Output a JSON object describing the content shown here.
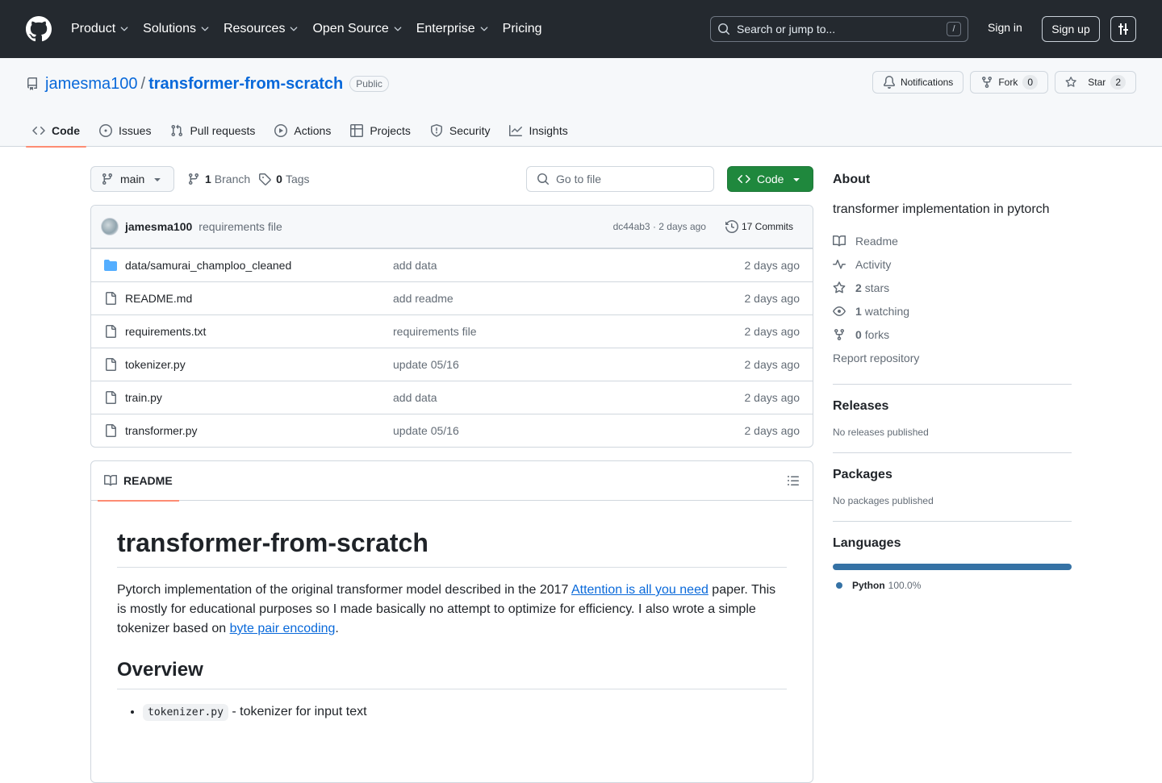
{
  "header": {
    "nav": [
      {
        "label": "Product",
        "dropdown": true
      },
      {
        "label": "Solutions",
        "dropdown": true
      },
      {
        "label": "Resources",
        "dropdown": true
      },
      {
        "label": "Open Source",
        "dropdown": true
      },
      {
        "label": "Enterprise",
        "dropdown": true
      },
      {
        "label": "Pricing",
        "dropdown": false
      }
    ],
    "search_placeholder": "Search or jump to...",
    "search_key": "/",
    "signin": "Sign in",
    "signup": "Sign up"
  },
  "repo": {
    "owner": "jamesma100",
    "separator": "/",
    "name": "transformer-from-scratch",
    "visibility": "Public",
    "notifications_label": "Notifications",
    "fork_label": "Fork",
    "fork_count": "0",
    "star_label": "Star",
    "star_count": "2"
  },
  "repo_nav": [
    {
      "label": "Code",
      "icon": "code-icon",
      "active": true
    },
    {
      "label": "Issues",
      "icon": "issue-icon",
      "active": false
    },
    {
      "label": "Pull requests",
      "icon": "pull-request-icon",
      "active": false
    },
    {
      "label": "Actions",
      "icon": "play-icon",
      "active": false
    },
    {
      "label": "Projects",
      "icon": "table-icon",
      "active": false
    },
    {
      "label": "Security",
      "icon": "shield-icon",
      "active": false
    },
    {
      "label": "Insights",
      "icon": "graph-icon",
      "active": false
    }
  ],
  "toolbar": {
    "branch": "main",
    "branch_count": "1",
    "branch_label": "Branch",
    "tag_count": "0",
    "tag_label": "Tags",
    "goto_placeholder": "Go to file",
    "code_label": "Code"
  },
  "commit": {
    "author": "jamesma100",
    "message": "requirements file",
    "meta": "dc44ab3 · 2 days ago",
    "commits_label": "17 Commits"
  },
  "files": [
    {
      "type": "folder",
      "name": "data/samurai_champloo_cleaned",
      "message": "add data",
      "date": "2 days ago"
    },
    {
      "type": "file",
      "name": "README.md",
      "message": "add readme",
      "date": "2 days ago"
    },
    {
      "type": "file",
      "name": "requirements.txt",
      "message": "requirements file",
      "date": "2 days ago"
    },
    {
      "type": "file",
      "name": "tokenizer.py",
      "message": "update 05/16",
      "date": "2 days ago"
    },
    {
      "type": "file",
      "name": "train.py",
      "message": "add data",
      "date": "2 days ago"
    },
    {
      "type": "file",
      "name": "transformer.py",
      "message": "update 05/16",
      "date": "2 days ago"
    }
  ],
  "readme": {
    "tab_label": "README",
    "title": "transformer-from-scratch",
    "p1_before": "Pytorch implementation of the original transformer model described in the 2017 ",
    "p1_link": "Attention is all you need",
    "p1_middle": " paper. This is mostly for educational purposes so I made basically no attempt to optimize for efficiency. I also wrote a simple tokenizer based on ",
    "p1_link2": "byte pair encoding",
    "p1_after": ".",
    "h2": "Overview",
    "list": [
      {
        "code": "tokenizer.py",
        "text": " - tokenizer for input text"
      }
    ]
  },
  "sidebar": {
    "about_title": "About",
    "about_desc": "transformer implementation in pytorch",
    "links": [
      {
        "icon": "book-icon",
        "count": "",
        "label": "Readme"
      },
      {
        "icon": "pulse-icon",
        "count": "",
        "label": "Activity"
      },
      {
        "icon": "star-icon",
        "count": "2",
        "label": "stars"
      },
      {
        "icon": "eye-icon",
        "count": "1",
        "label": "watching"
      },
      {
        "icon": "fork-icon",
        "count": "0",
        "label": "forks"
      }
    ],
    "report": "Report repository",
    "releases_title": "Releases",
    "releases_text": "No releases published",
    "packages_title": "Packages",
    "packages_text": "No packages published",
    "languages_title": "Languages",
    "languages": [
      {
        "name": "Python",
        "percent": "100.0%",
        "color": "#3572A5"
      }
    ]
  },
  "colors": {
    "header_bg": "#24292f",
    "link": "#0969da",
    "primary_button": "#1f883d",
    "active_tab_underline": "#fd8c73"
  }
}
